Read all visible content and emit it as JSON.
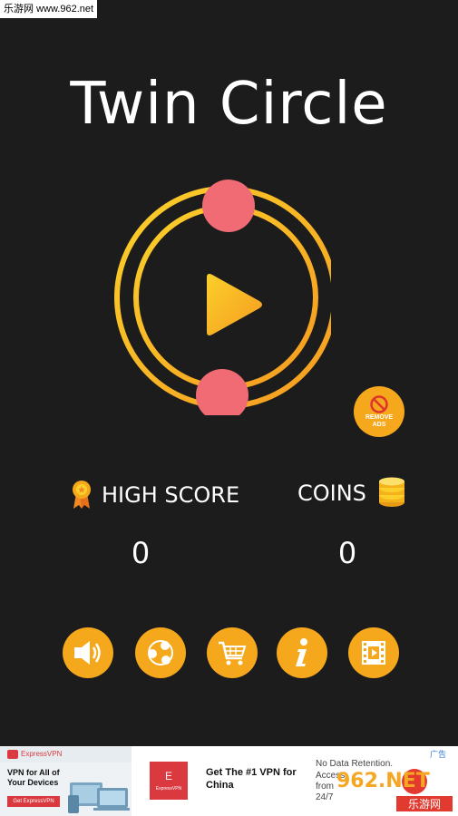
{
  "watermark": {
    "top_text": "乐游网 www.962.net",
    "bottom_text": "962.NET",
    "bottom_sub": "乐游网"
  },
  "game": {
    "title": "Twin Circle",
    "play_icon": "play-icon",
    "remove_ads_label": "REMOVE ADS",
    "high_score_label": "HIGH SCORE",
    "high_score_value": "0",
    "coins_label": "COINS",
    "coins_value": "0",
    "buttons": [
      {
        "name": "sound-button",
        "icon": "speaker-icon"
      },
      {
        "name": "share-button",
        "icon": "share-icon"
      },
      {
        "name": "shop-button",
        "icon": "cart-icon"
      },
      {
        "name": "info-button",
        "icon": "info-icon"
      },
      {
        "name": "video-button",
        "icon": "film-icon"
      }
    ]
  },
  "colors": {
    "background": "#1c1c1c",
    "ring_start": "#fbd02a",
    "ring_end": "#f59b20",
    "ball": "#f06b74",
    "button": "#f6a81c"
  },
  "ad": {
    "left_brand": "ExpressVPN",
    "left_headline": "VPN for All of Your Devices",
    "left_cta": "Get ExpressVPN",
    "logo_text": "ExpressVPN",
    "headline": "Get The #1 VPN for China",
    "right_line1": "No Data Retention.",
    "right_line2": "Access",
    "right_line3": "from",
    "right_line4": "24/7",
    "ad_tag": "广告"
  }
}
